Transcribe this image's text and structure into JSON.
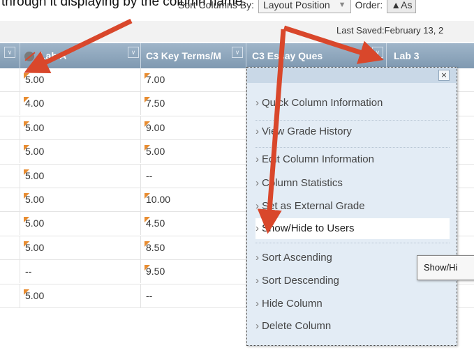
{
  "caption": "through it displaying by the column name.",
  "toolbar": {
    "sort_label": "Sort Columns By:",
    "sort_value": "Layout Position",
    "order_label": "Order:",
    "order_value": "▲As"
  },
  "saved_text": "Last Saved:February 13, 2",
  "columns": [
    "Lab 3",
    "C3 Key Terms/M",
    "C3 Essay Ques",
    "Lab 3"
  ],
  "col1_label": "Lab A",
  "rows": [
    [
      "5.00",
      "7.00"
    ],
    [
      "4.00",
      "7.50"
    ],
    [
      "5.00",
      "9.00"
    ],
    [
      "5.00",
      "5.00"
    ],
    [
      "5.00",
      "--"
    ],
    [
      "5.00",
      "10.00"
    ],
    [
      "5.00",
      "4.50"
    ],
    [
      "5.00",
      "8.50"
    ],
    [
      "--",
      "9.50"
    ],
    [
      "5.00",
      "--"
    ]
  ],
  "flags": [
    [
      true,
      true
    ],
    [
      true,
      true
    ],
    [
      true,
      true
    ],
    [
      true,
      true
    ],
    [
      true,
      false
    ],
    [
      true,
      true
    ],
    [
      true,
      true
    ],
    [
      true,
      true
    ],
    [
      false,
      true
    ],
    [
      true,
      false
    ]
  ],
  "menu": {
    "close": "×",
    "items": [
      "Quick Column Information",
      "View Grade History",
      "Edit Column Information",
      "Column Statistics",
      "Set as External Grade",
      "Show/Hide to Users",
      "Sort Ascending",
      "Sort Descending",
      "Hide Column",
      "Delete Column"
    ]
  },
  "tooltip": "Show/Hi",
  "colors": {
    "arrow": "#d9472b",
    "header": "#8ea8bf",
    "menu_bg": "#e3ecf5",
    "flag": "#e88c30"
  }
}
